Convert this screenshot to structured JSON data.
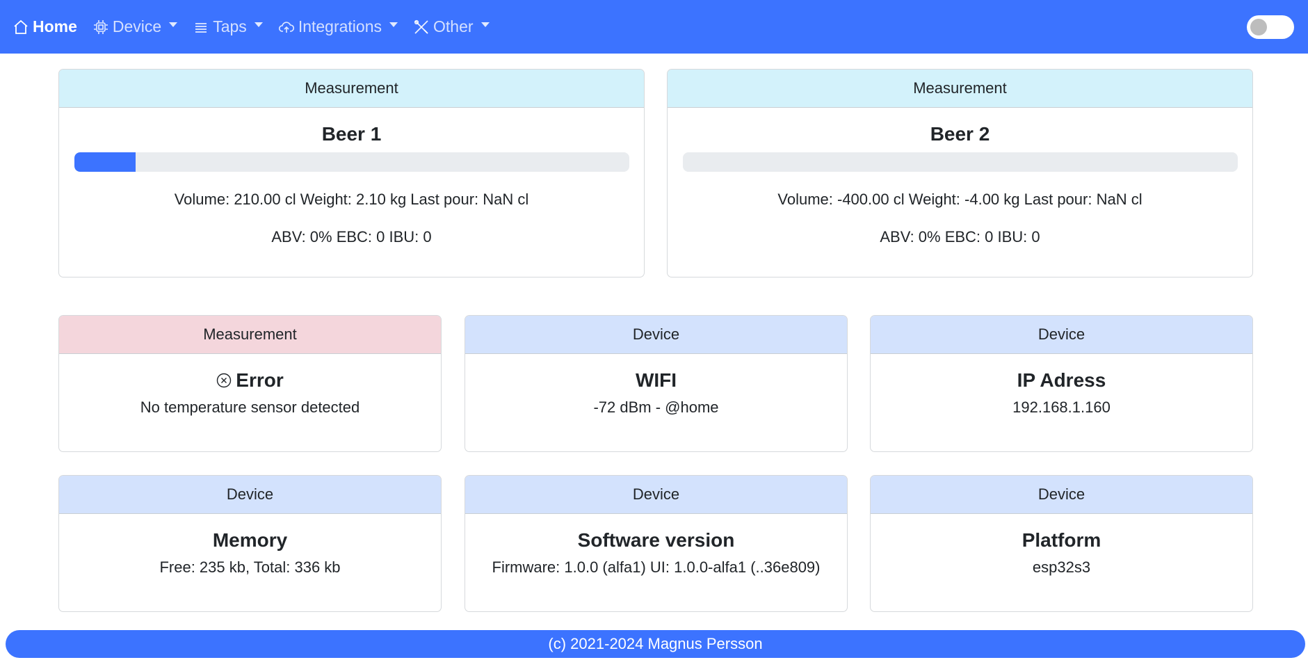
{
  "nav": {
    "home": "Home",
    "device": "Device",
    "taps": "Taps",
    "integrations": "Integrations",
    "other": "Other"
  },
  "beer1": {
    "header": "Measurement",
    "title": "Beer 1",
    "progress_percent": 11,
    "line1": "Volume: 210.00 cl Weight: 2.10 kg Last pour: NaN cl",
    "line2": "ABV: 0% EBC: 0 IBU: 0"
  },
  "beer2": {
    "header": "Measurement",
    "title": "Beer 2",
    "progress_percent": 0,
    "line1": "Volume: -400.00 cl Weight: -4.00 kg Last pour: NaN cl",
    "line2": "ABV: 0% EBC: 0 IBU: 0"
  },
  "error_card": {
    "header": "Measurement",
    "title": "Error",
    "text": "No temperature sensor detected"
  },
  "wifi_card": {
    "header": "Device",
    "title": "WIFI",
    "text": "-72 dBm - @home"
  },
  "ip_card": {
    "header": "Device",
    "title": "IP Adress",
    "text": "192.168.1.160"
  },
  "memory_card": {
    "header": "Device",
    "title": "Memory",
    "text": "Free: 235 kb, Total: 336 kb"
  },
  "software_card": {
    "header": "Device",
    "title": "Software version",
    "text": "Firmware: 1.0.0 (alfa1) UI: 1.0.0-alfa1 (..36e809)"
  },
  "platform_card": {
    "header": "Device",
    "title": "Platform",
    "text": "esp32s3"
  },
  "footer": {
    "text": "(c) 2021-2024 Magnus Persson"
  },
  "colors": {
    "primary": "#3c73ff",
    "info_header": "#d3f2fb",
    "danger_header": "#f4d6dc",
    "primary_header": "#d3e2fd"
  }
}
